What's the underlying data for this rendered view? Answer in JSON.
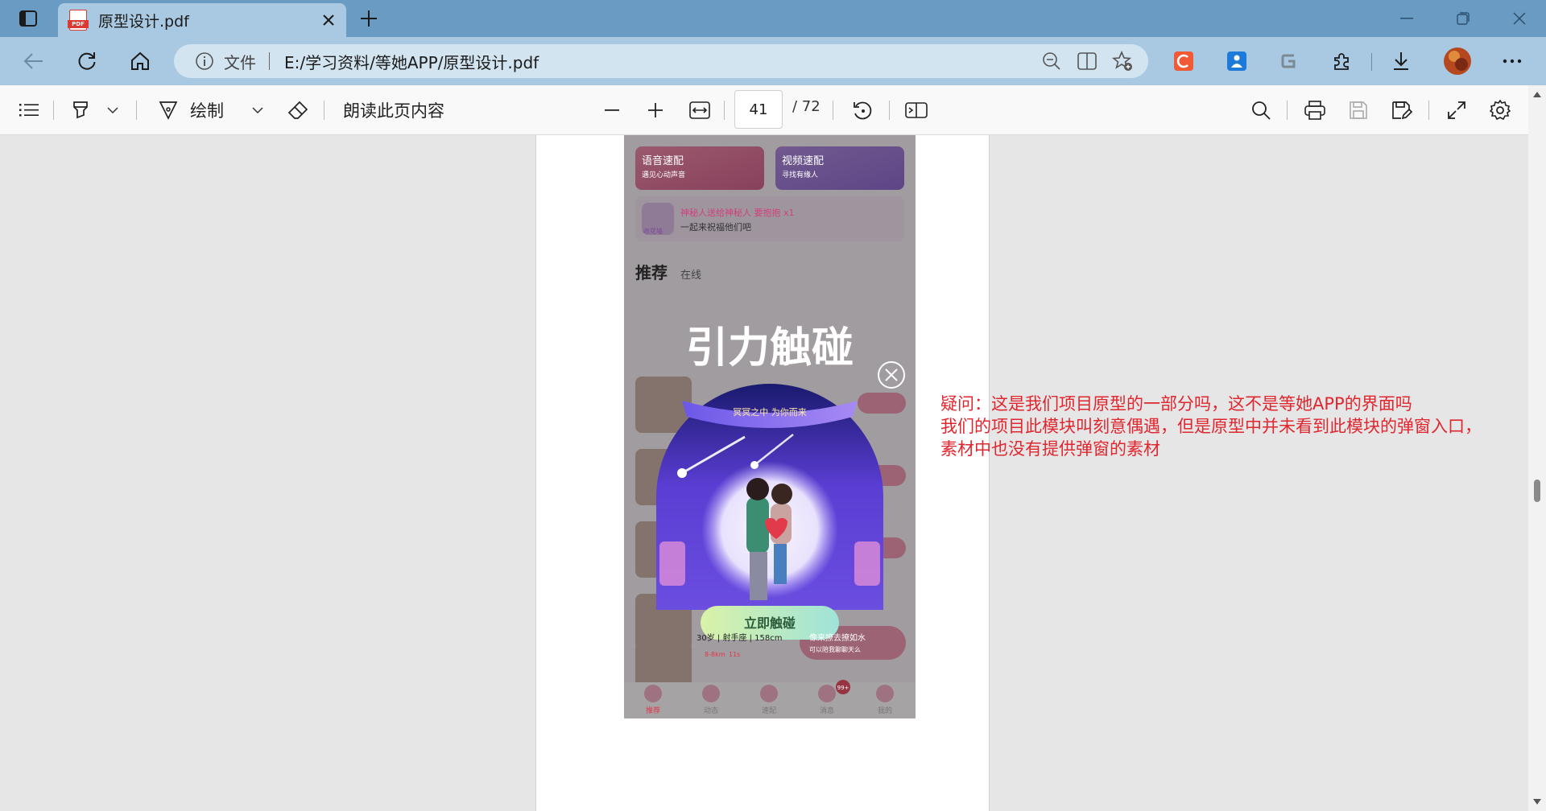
{
  "browser": {
    "tab": {
      "title": "原型设计.pdf"
    },
    "address": {
      "scheme_label": "文件",
      "url": "E:/学习资料/等她APP/原型设计.pdf"
    }
  },
  "pdf_toolbar": {
    "draw_label": "绘制",
    "read_aloud_label": "朗读此页内容",
    "current_page": "41",
    "page_count": "/ 72"
  },
  "phone": {
    "card_voice": {
      "title": "语音速配",
      "sub": "遇见心动声音"
    },
    "card_video": {
      "title": "视频速配",
      "sub": "寻找有缘人"
    },
    "broadcast": {
      "line1": "神秘人送给神秘人 要抱抱 x1",
      "line2": "一起来祝福他们吧",
      "badge": "收花墙"
    },
    "tab_recommend": "推荐",
    "tab_online": "在线",
    "popup": {
      "title": "引力触碰",
      "ribbon": "冥冥之中 为你而来",
      "button": "立即触碰"
    },
    "list_item": {
      "name": "30岁 | 射手座 | 158cm",
      "tag_text": "像来撩去撩如水",
      "tag_sub": "可以陪我聊聊天么",
      "meta1": "8-8km",
      "meta2": "11s"
    },
    "msg_badge": "99+",
    "bottom_nav": [
      "推荐",
      "动态",
      "速配",
      "消息",
      "我的"
    ]
  },
  "annotation": {
    "line1": "疑问：这是我们项目原型的一部分吗，这不是等她APP的界面吗",
    "line2": "我们的项目此模块叫刻意偶遇，但是原型中并未看到此模块的弹窗入口，",
    "line3": "素材中也没有提供弹窗的素材"
  }
}
